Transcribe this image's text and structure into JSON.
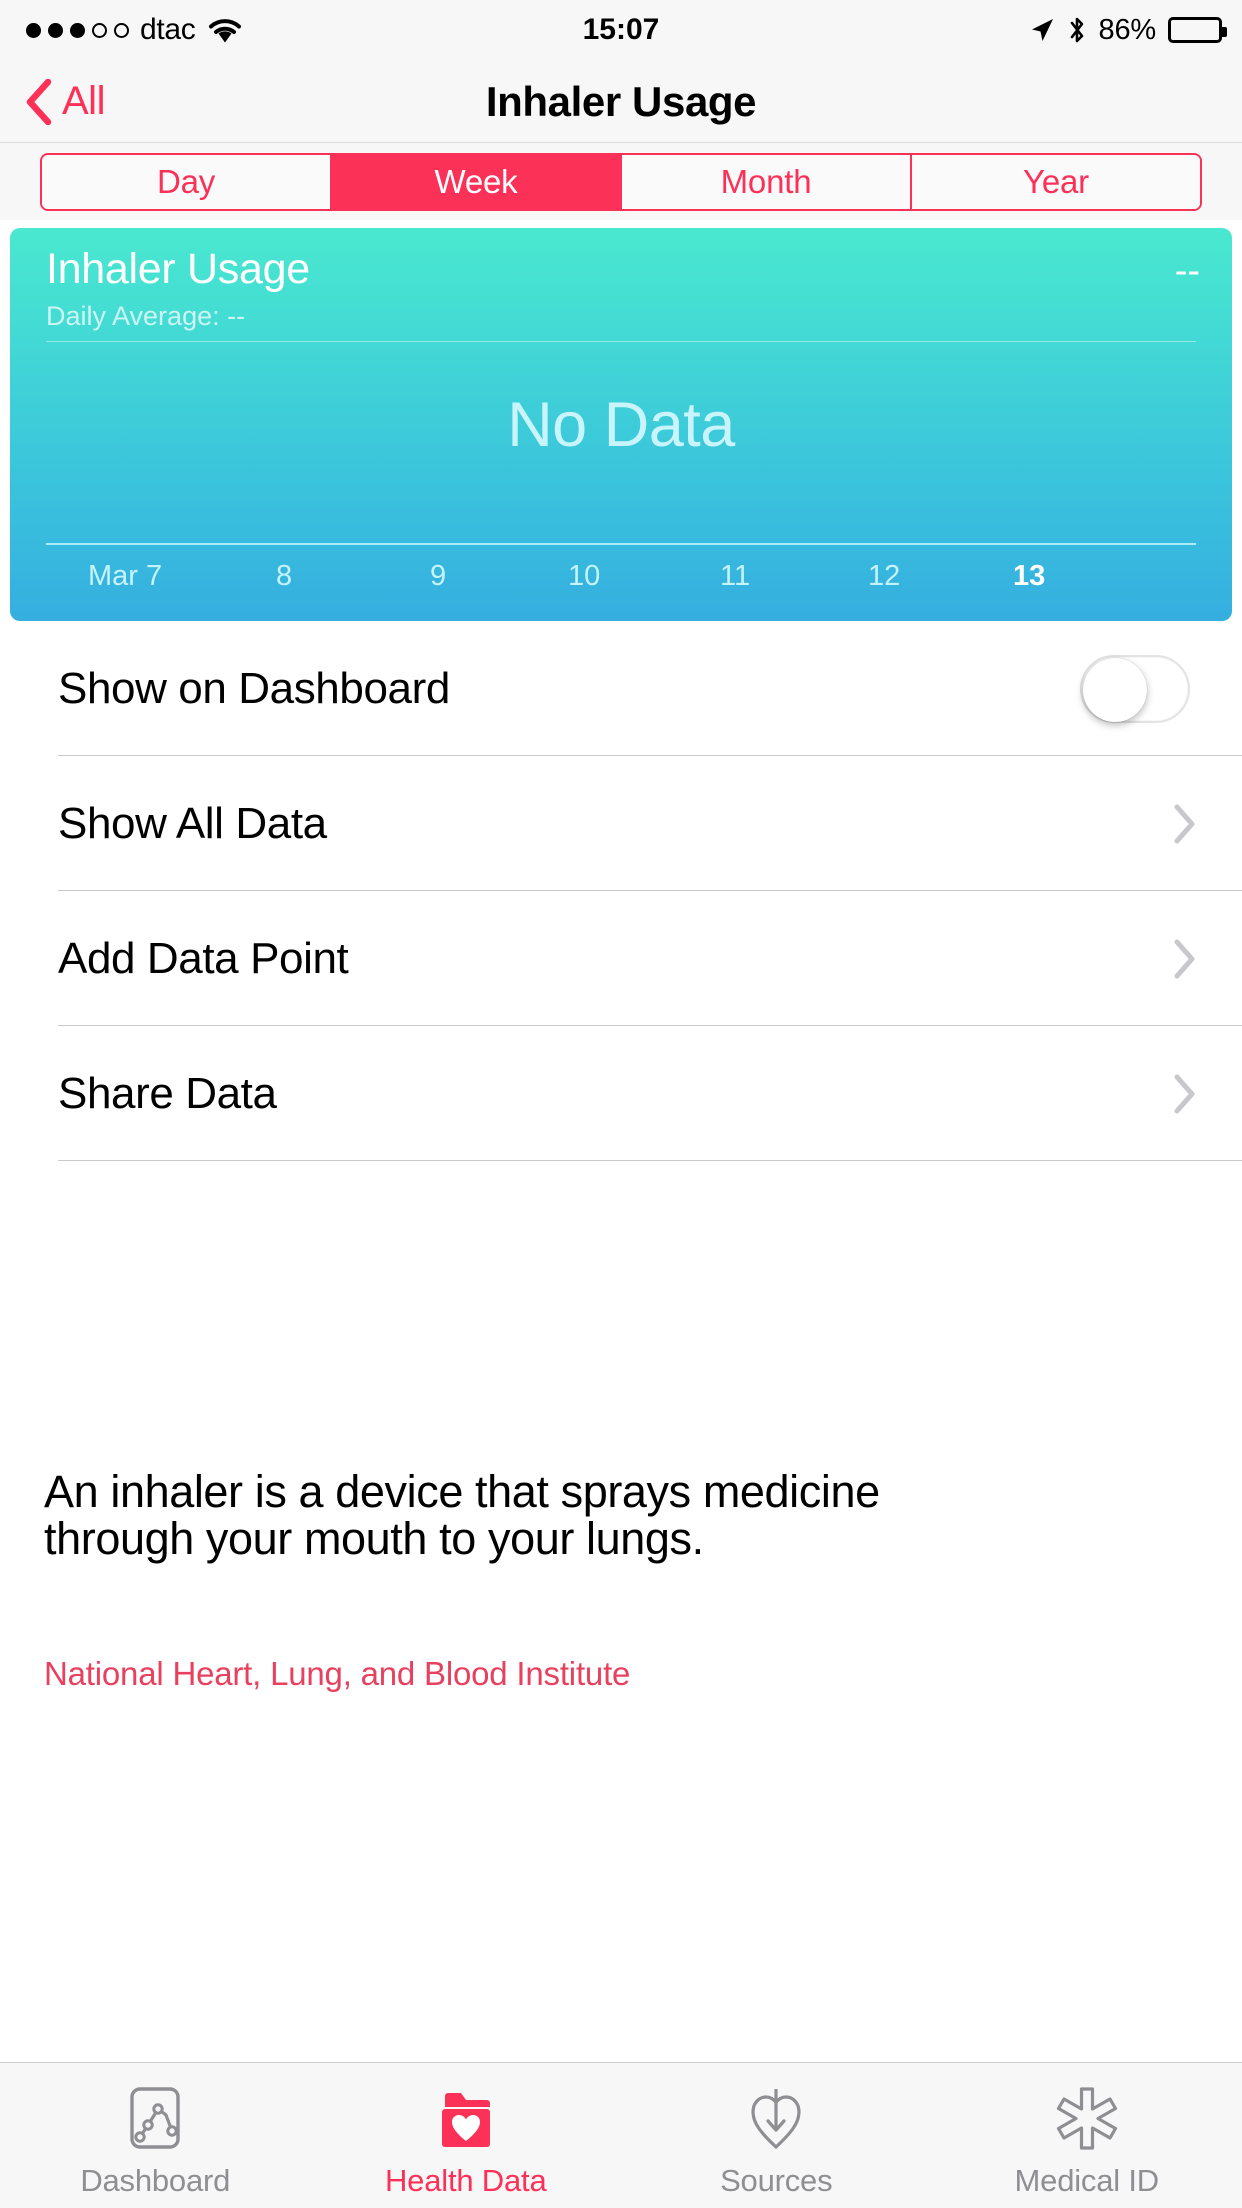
{
  "status_bar": {
    "signal_dots_filled": 3,
    "signal_dots_total": 5,
    "carrier": "dtac",
    "wifi_icon": "wifi-icon",
    "time": "15:07",
    "location_icon": "location-arrow-icon",
    "bluetooth_icon": "bluetooth-icon",
    "battery_percent": "86%",
    "battery_level": 86
  },
  "nav": {
    "back_icon": "chevron-left-icon",
    "back_label": "All",
    "title": "Inhaler Usage"
  },
  "segmented": {
    "options": [
      "Day",
      "Week",
      "Month",
      "Year"
    ],
    "selected": "Week",
    "accent_color": "#fc3158"
  },
  "chart_data": {
    "type": "bar",
    "title": "Inhaler Usage",
    "subtitle": "Daily Average: --",
    "value": "--",
    "empty_message": "No Data",
    "categories": [
      "Mar 7",
      "8",
      "9",
      "10",
      "11",
      "12",
      "13"
    ],
    "values": [
      null,
      null,
      null,
      null,
      null,
      null,
      null
    ],
    "xlabel": "",
    "ylabel": "",
    "highlight_category": "13",
    "grid": false,
    "legend": "none",
    "gradient_from": "#4ae8d0",
    "gradient_to": "#35aee0"
  },
  "settings": {
    "rows": [
      {
        "label": "Show on Dashboard",
        "control": "toggle",
        "value": "off"
      },
      {
        "label": "Show All Data",
        "control": "chevron"
      },
      {
        "label": "Add Data Point",
        "control": "chevron"
      },
      {
        "label": "Share Data",
        "control": "chevron"
      }
    ]
  },
  "description": {
    "line1": "An inhaler is a device that sprays medicine",
    "line2": "through your mouth to your lungs.",
    "attribution": "National Heart, Lung, and Blood Institute",
    "attribution_color": "#e8415f"
  },
  "tabbar": {
    "tabs": [
      {
        "label": "Dashboard",
        "icon": "dashboard-chart-icon",
        "active": false
      },
      {
        "label": "Health Data",
        "icon": "health-data-folder-heart-icon",
        "active": true
      },
      {
        "label": "Sources",
        "icon": "sources-download-heart-icon",
        "active": false
      },
      {
        "label": "Medical ID",
        "icon": "medical-id-asterisk-icon",
        "active": false
      }
    ],
    "active_color": "#fc3158",
    "inactive_color": "#8e8e93"
  }
}
